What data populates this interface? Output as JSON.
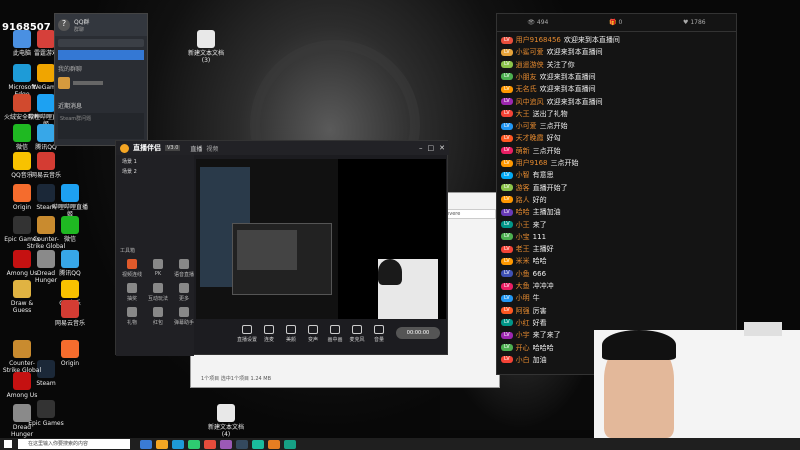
{
  "desktop": {
    "top_left_label": "9168507",
    "icons": [
      {
        "label": "此电脑",
        "color": "#4a90e2"
      },
      {
        "label": "雷霆游戏",
        "color": "#d6403a"
      },
      {
        "label": "Microsoft Edge",
        "color": "#1e9bd7"
      },
      {
        "label": "WeGame",
        "color": "#f0a500"
      },
      {
        "label": "火绒安全软件",
        "color": "#d14a2e"
      },
      {
        "label": "哔哩哔哩直播姬",
        "color": "#1da1f2"
      },
      {
        "label": "微信",
        "color": "#1fb922"
      },
      {
        "label": "腾讯QQ",
        "color": "#37a7e8"
      },
      {
        "label": "QQ音乐",
        "color": "#f8c200"
      },
      {
        "label": "网易云音乐",
        "color": "#d43c33"
      },
      {
        "label": "Origin",
        "color": "#f56c2d"
      },
      {
        "label": "Steam",
        "color": "#1b2838"
      },
      {
        "label": "Epic Games",
        "color": "#333333"
      },
      {
        "label": "Counter-Strike Global Off...",
        "color": "#c98b2f"
      },
      {
        "label": "Among Us",
        "color": "#c51111"
      },
      {
        "label": "Dread Hunger",
        "color": "#8a8a8a"
      },
      {
        "label": "Draw & Guess",
        "color": "#e0b342"
      }
    ],
    "folder_label": "新建文本文档 (3)",
    "bottom_folder_label": "新建文本文档 (4)"
  },
  "qq_panel": {
    "title": "QQ群",
    "subtitle": "群聊",
    "group_header": "我的群聊",
    "notice": "近期消息",
    "bottom_text": "Steam群问题"
  },
  "douyu": {
    "app_title": "直播伴侣",
    "version": "V3.0",
    "tabs": [
      "直播",
      "视频"
    ],
    "scenes": [
      "场景 1",
      "场景 2"
    ],
    "tools_header": "工具箱",
    "tools": [
      "视频连线",
      "PK",
      "语音直播",
      "抽奖",
      "互动玩法",
      "更多",
      "礼物",
      "红包",
      "弹幕助手"
    ],
    "preview_tabs": [
      "全部场景",
      "游戏",
      "桌面"
    ],
    "controls": [
      "直播设置",
      "连麦",
      "美颜",
      "变声",
      "画中画",
      "麦克风",
      "音量",
      "开始直播"
    ],
    "live_timer": "00:00:00"
  },
  "chat": {
    "header_left": "弹幕",
    "header_mid": "礼物",
    "header_right": "贡献榜",
    "counts": [
      "494",
      "0",
      "1786"
    ],
    "lines": [
      {
        "user": "用户9168456",
        "msg": "欢迎来到本直播间",
        "badge": "#e94e3c"
      },
      {
        "user": "小鲨可爱",
        "msg": "欢迎来到本直播间",
        "badge": "#e7a33a"
      },
      {
        "user": "逍遥游侠",
        "msg": "关注了你",
        "badge": "#8bc34a"
      },
      {
        "user": "小朋友",
        "msg": "欢迎来到本直播间",
        "badge": "#4caf50"
      },
      {
        "user": "无名氏",
        "msg": "欢迎来到本直播间",
        "badge": "#ff9800"
      },
      {
        "user": "风中追风",
        "msg": "欢迎来到本直播间",
        "badge": "#9c27b0"
      },
      {
        "user": "大王",
        "msg": "送出了礼物",
        "badge": "#f44336"
      },
      {
        "user": "小可爱",
        "msg": "三点开始",
        "badge": "#2196f3"
      },
      {
        "user": "天才晚霞",
        "msg": "好勾",
        "badge": "#ff5722"
      },
      {
        "user": "萌新",
        "msg": "三点开始",
        "badge": "#e91e63"
      },
      {
        "user": "用户9168",
        "msg": "三点开始",
        "badge": "#ff9800"
      },
      {
        "user": "小智",
        "msg": "有意思",
        "badge": "#03a9f4"
      },
      {
        "user": "游客",
        "msg": "直播开始了",
        "badge": "#8bc34a"
      },
      {
        "user": "路人",
        "msg": "好的",
        "badge": "#ff9800"
      },
      {
        "user": "哈哈",
        "msg": "主播加油",
        "badge": "#673ab7"
      },
      {
        "user": "小王",
        "msg": "来了",
        "badge": "#009688"
      },
      {
        "user": "小宝",
        "msg": "111",
        "badge": "#4caf50"
      },
      {
        "user": "老王",
        "msg": "主播好",
        "badge": "#f44336"
      },
      {
        "user": "米米",
        "msg": "哈哈",
        "badge": "#ff9800"
      },
      {
        "user": "小鱼",
        "msg": "666",
        "badge": "#3f51b5"
      },
      {
        "user": "大鱼",
        "msg": "冲冲冲",
        "badge": "#e91e63"
      },
      {
        "user": "小明",
        "msg": "牛",
        "badge": "#2196f3"
      },
      {
        "user": "阿强",
        "msg": "厉害",
        "badge": "#ff5722"
      },
      {
        "user": "小红",
        "msg": "好看",
        "badge": "#009688"
      },
      {
        "user": "小宇",
        "msg": "来了来了",
        "badge": "#9c27b0"
      },
      {
        "user": "开心",
        "msg": "哈哈哈",
        "badge": "#4caf50"
      },
      {
        "user": "小白",
        "msg": "加油",
        "badge": "#f44336"
      }
    ]
  },
  "explorer": {
    "search_text": "Severe",
    "status": "1个项目 选中1个项目 1.24 MB"
  },
  "taskbar": {
    "search_placeholder": "在这里输入你要搜索的内容",
    "time": "",
    "apps": [
      "#3a7bd5",
      "#f5a623",
      "#1e9bd7",
      "#2ecc71",
      "#e74c3c",
      "#9b59b6",
      "#34495e",
      "#1abc9c",
      "#e67e22",
      "#16a085"
    ]
  }
}
